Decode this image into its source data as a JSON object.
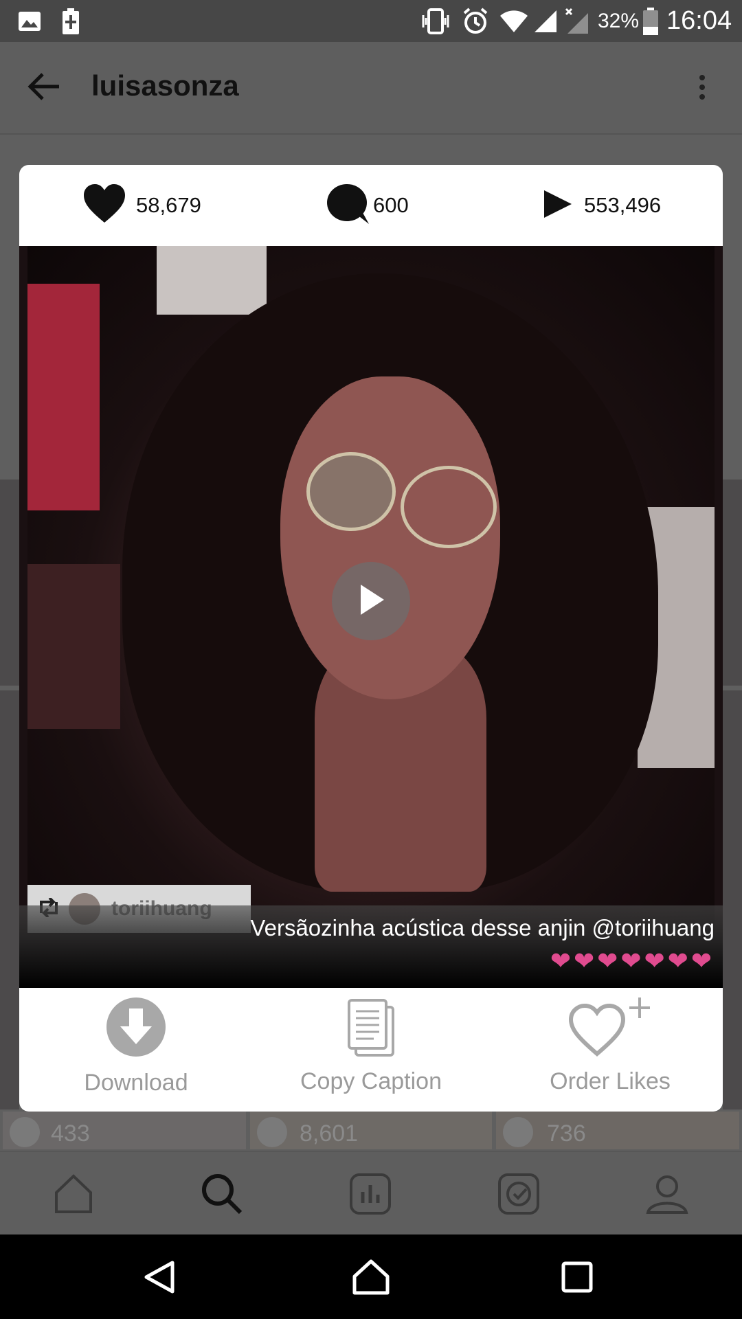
{
  "status_bar": {
    "battery_pct": "32%",
    "time": "16:04"
  },
  "header": {
    "title": "luisasonza"
  },
  "post_stats": {
    "likes": "58,679",
    "comments": "600",
    "views": "553,496"
  },
  "media": {
    "repost_user": "toriihuang",
    "caption": "Versãozinha acústica desse anjin @toriihuang",
    "caption_emojis": "❤❤❤❤❤❤❤"
  },
  "actions": {
    "download_label": "Download",
    "copy_caption_label": "Copy Caption",
    "order_likes_label": "Order Likes"
  },
  "grid_counts": [
    "433",
    "8,601",
    "736"
  ],
  "colors": {
    "overlay_bg": "#5f5f5f",
    "caption_heart": "#e04b8f",
    "action_gray": "#9a9a9a"
  }
}
